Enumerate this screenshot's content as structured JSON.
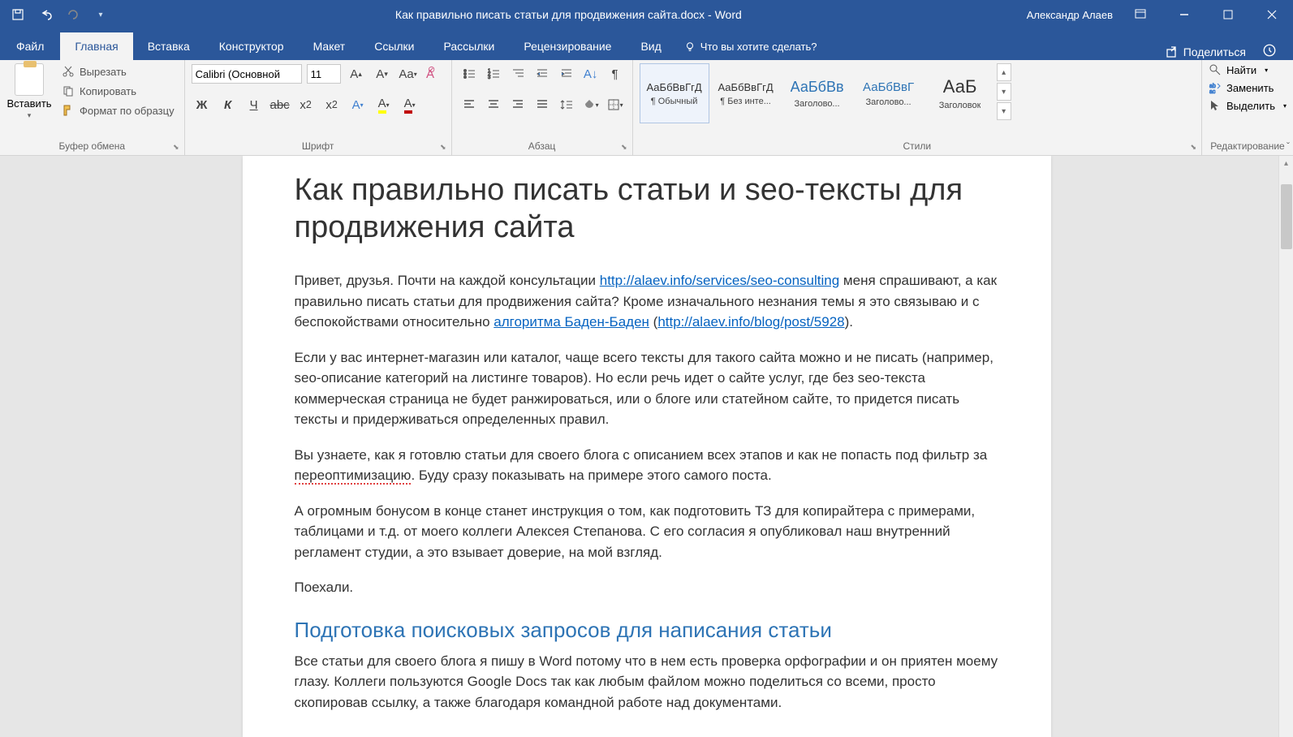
{
  "titlebar": {
    "document_title": "Как правильно писать статьи для продвижения сайта.docx - Word",
    "user": "Александр Алаев"
  },
  "tabs": {
    "file": "Файл",
    "home": "Главная",
    "insert": "Вставка",
    "design": "Конструктор",
    "layout": "Макет",
    "references": "Ссылки",
    "mailings": "Рассылки",
    "review": "Рецензирование",
    "view": "Вид",
    "tellme_placeholder": "Что вы хотите сделать?",
    "share": "Поделиться"
  },
  "ribbon": {
    "clipboard": {
      "paste": "Вставить",
      "cut": "Вырезать",
      "copy": "Копировать",
      "format_painter": "Формат по образцу",
      "label": "Буфер обмена"
    },
    "font": {
      "name": "Calibri (Основной",
      "size": "11",
      "bold": "Ж",
      "italic": "К",
      "underline": "Ч",
      "label": "Шрифт"
    },
    "paragraph": {
      "label": "Абзац"
    },
    "styles": {
      "label": "Стили",
      "items": [
        {
          "preview": "АаБбВвГгД",
          "name": "¶ Обычный"
        },
        {
          "preview": "АаБбВвГгД",
          "name": "¶ Без инте..."
        },
        {
          "preview": "АаБбВв",
          "name": "Заголово..."
        },
        {
          "preview": "АаБбВвГ",
          "name": "Заголово..."
        },
        {
          "preview": "АаБ",
          "name": "Заголовок"
        }
      ]
    },
    "editing": {
      "find": "Найти",
      "replace": "Заменить",
      "select": "Выделить",
      "label": "Редактирование"
    }
  },
  "document": {
    "title": "Как правильно писать статьи и seo-тексты для продвижения сайта",
    "p1_a": "Привет, друзья. Почти на каждой консультации ",
    "p1_link1": "http://alaev.info/services/seo-consulting",
    "p1_b": " меня спрашивают, а как правильно писать статьи для продвижения сайта? Кроме изначального незнания темы я это связываю и с беспокойствами относительно ",
    "p1_link2": "алгоритма Баден-Баден",
    "p1_c": " (",
    "p1_link3": "http://alaev.info/blog/post/5928",
    "p1_d": ").",
    "p2": "Если у вас интернет-магазин или каталог, чаще всего тексты для такого сайта можно и не писать (например, seo-описание категорий на листинге товаров). Но если речь идет о сайте услуг, где без seo-текста коммерческая страница не будет ранжироваться, или о блоге или статейном сайте, то придется писать тексты и придерживаться определенных правил.",
    "p3_a": "Вы узнаете, как я готовлю статьи для своего блога с описанием всех этапов и как не попасть под фильтр за ",
    "p3_err": "переоптимизацию",
    "p3_b": ". Буду сразу показывать на примере этого самого поста.",
    "p4": "А огромным бонусом в конце станет инструкция о том, как подготовить ТЗ для копирайтера с примерами, таблицами и т.д. от моего коллеги Алексея Степанова. С его согласия я опубликовал наш внутренний регламент студии, а это взывает доверие, на мой взгляд.",
    "p5": "Поехали.",
    "h2": "Подготовка поисковых запросов для написания статьи",
    "p6": "Все статьи для своего блога я пишу в Word потому что в нем есть проверка орфографии и он приятен моему глазу. Коллеги пользуются Google Docs так как любым файлом можно поделиться со всеми, просто скопировав ссылку, а также благодаря командной работе над документами."
  }
}
